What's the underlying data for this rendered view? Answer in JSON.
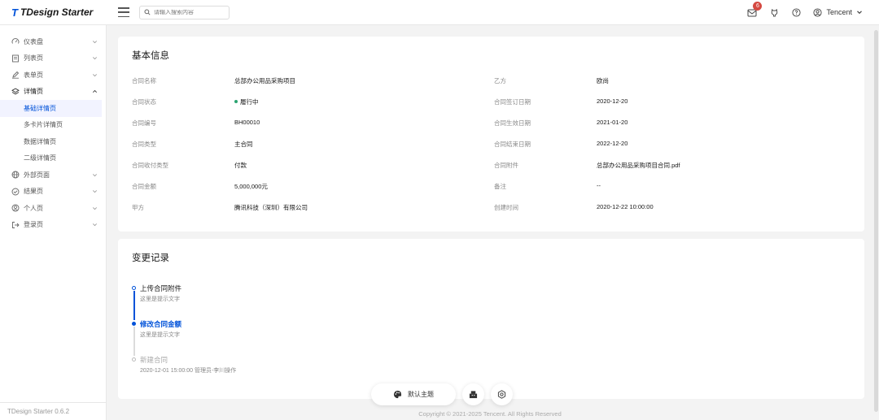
{
  "header": {
    "logo_text": "TDesign Starter",
    "search_placeholder": "请输入搜索内容",
    "notification_count": "6",
    "user_name": "Tencent"
  },
  "sidebar": {
    "items": [
      {
        "label": "仪表盘",
        "icon": "dashboard-icon"
      },
      {
        "label": "列表页",
        "icon": "list-icon"
      },
      {
        "label": "表单页",
        "icon": "edit-icon"
      },
      {
        "label": "详情页",
        "icon": "layers-icon"
      },
      {
        "label": "外部页面",
        "icon": "globe-icon"
      },
      {
        "label": "结果页",
        "icon": "check-circle-icon"
      },
      {
        "label": "个人页",
        "icon": "user-circle-icon"
      },
      {
        "label": "登录页",
        "icon": "logout-icon"
      }
    ],
    "sub_items": [
      "基础详情页",
      "多卡片详情页",
      "数据详情页",
      "二级详情页"
    ],
    "footer": "TDesign Starter 0.6.2"
  },
  "info_card": {
    "title": "基本信息",
    "rows": [
      {
        "k1": "合同名称",
        "v1": "总部办公用品采购项目",
        "k2": "乙方",
        "v2": "欧尚"
      },
      {
        "k1": "合同状态",
        "v1": "履行中",
        "k2": "合同签订日期",
        "v2": "2020-12-20"
      },
      {
        "k1": "合同编号",
        "v1": "BH00010",
        "k2": "合同生效日期",
        "v2": "2021-01-20"
      },
      {
        "k1": "合同类型",
        "v1": "主合同",
        "k2": "合同结束日期",
        "v2": "2022-12-20"
      },
      {
        "k1": "合同收付类型",
        "v1": "付款",
        "k2": "合同附件",
        "v2": "总部办公用品采购项目合同.pdf"
      },
      {
        "k1": "合同金额",
        "v1": "5,000,000元",
        "k2": "备注",
        "v2": "--"
      },
      {
        "k1": "甲方",
        "v1": "腾讯科技（深圳）有限公司",
        "k2": "创建时间",
        "v2": "2020-12-22 10:00:00"
      }
    ]
  },
  "log_card": {
    "title": "变更记录",
    "items": [
      {
        "title": "上传合同附件",
        "sub": "这里是提示文字"
      },
      {
        "title": "修改合同金额",
        "sub": "这里是提示文字"
      },
      {
        "title": "新建合同",
        "sub": "2020-12-01 15:00:00 管理员-李川操作"
      }
    ]
  },
  "toolbar": {
    "theme_label": "默认主题"
  },
  "footer": {
    "copyright": "Copyright © 2021-2025 Tencent. All Rights Reserved"
  },
  "colors": {
    "brand": "#0052d9",
    "success": "#2ba471",
    "badge": "#d54941"
  }
}
